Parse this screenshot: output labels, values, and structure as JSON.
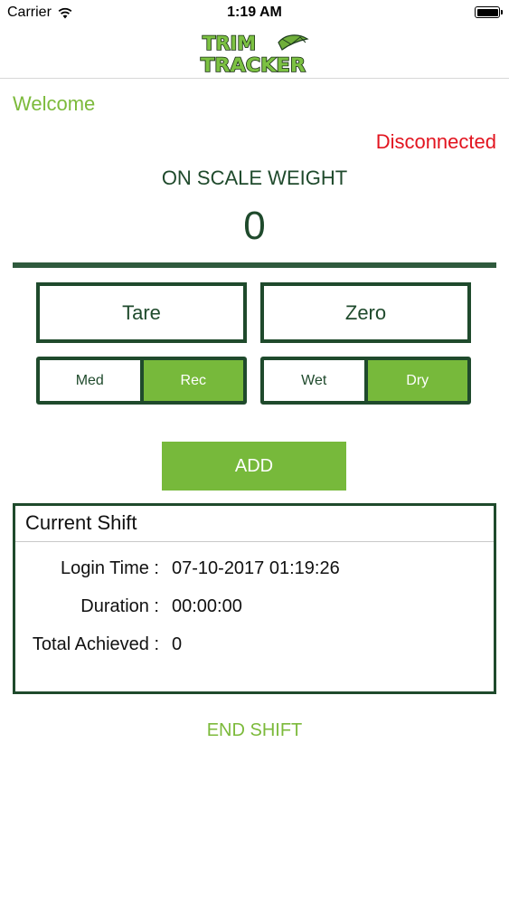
{
  "status_bar": {
    "carrier": "Carrier",
    "time": "1:19 AM"
  },
  "header": {
    "logo_line1": "TRIM",
    "logo_line2": "TRACKER"
  },
  "welcome_label": "Welcome",
  "connection_status": "Disconnected",
  "scale": {
    "title": "ON SCALE WEIGHT",
    "value": "0"
  },
  "buttons": {
    "tare": "Tare",
    "zero": "Zero",
    "add": "ADD",
    "end_shift": "END SHIFT"
  },
  "segment_type": {
    "options": [
      "Med",
      "Rec"
    ],
    "selected": "Rec"
  },
  "segment_state": {
    "options": [
      "Wet",
      "Dry"
    ],
    "selected": "Dry"
  },
  "current_shift": {
    "title": "Current Shift",
    "rows": [
      {
        "label": "Login Time :",
        "value": "07-10-2017 01:19:26"
      },
      {
        "label": "Duration :",
        "value": "00:00:00"
      },
      {
        "label": "Total Achieved :",
        "value": "0"
      }
    ]
  },
  "colors": {
    "accent_green": "#77b93b",
    "dark_green": "#1f4a2c",
    "error_red": "#e2141f"
  }
}
